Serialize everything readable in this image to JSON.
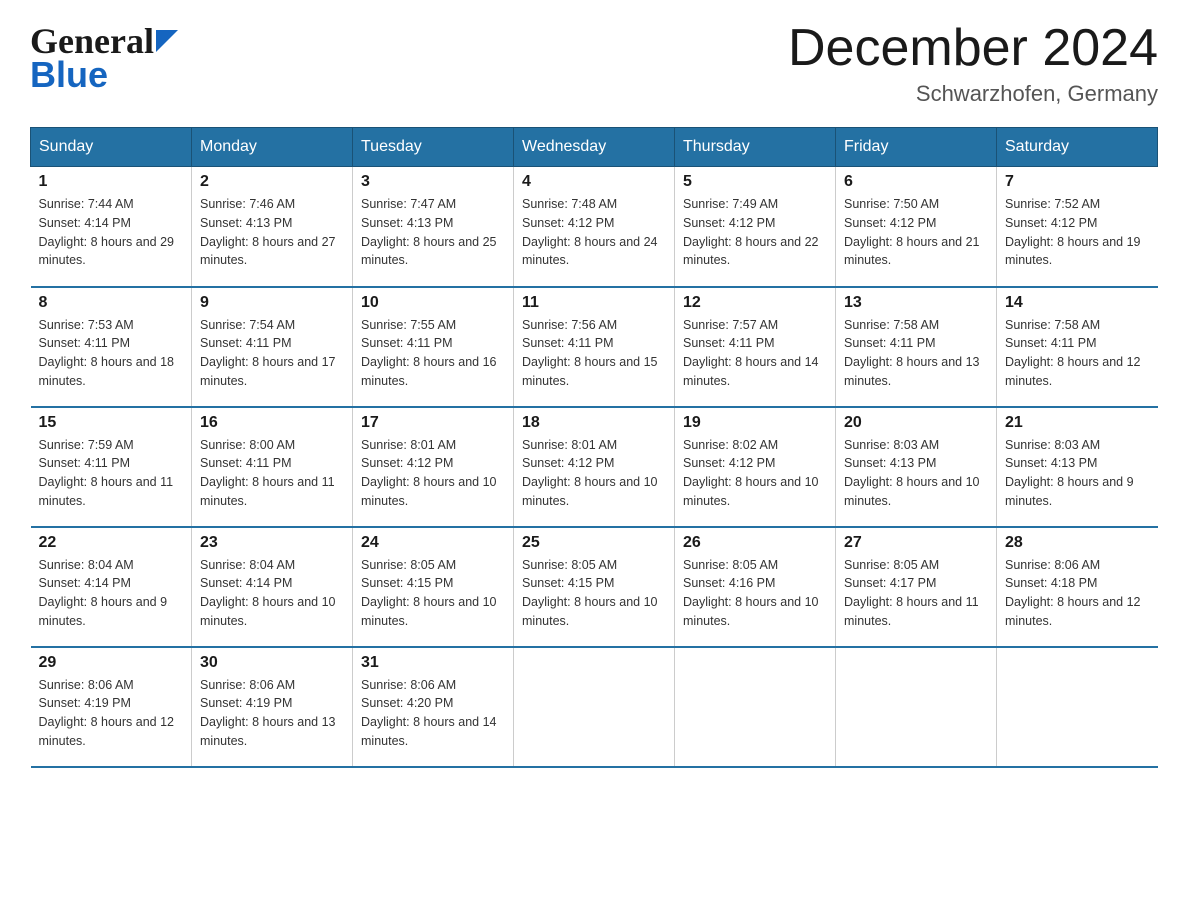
{
  "header": {
    "logo_general": "General",
    "logo_blue": "Blue",
    "month_title": "December 2024",
    "location": "Schwarzhofen, Germany"
  },
  "days_of_week": [
    "Sunday",
    "Monday",
    "Tuesday",
    "Wednesday",
    "Thursday",
    "Friday",
    "Saturday"
  ],
  "weeks": [
    [
      {
        "day": "1",
        "sunrise": "7:44 AM",
        "sunset": "4:14 PM",
        "daylight": "8 hours and 29 minutes."
      },
      {
        "day": "2",
        "sunrise": "7:46 AM",
        "sunset": "4:13 PM",
        "daylight": "8 hours and 27 minutes."
      },
      {
        "day": "3",
        "sunrise": "7:47 AM",
        "sunset": "4:13 PM",
        "daylight": "8 hours and 25 minutes."
      },
      {
        "day": "4",
        "sunrise": "7:48 AM",
        "sunset": "4:12 PM",
        "daylight": "8 hours and 24 minutes."
      },
      {
        "day": "5",
        "sunrise": "7:49 AM",
        "sunset": "4:12 PM",
        "daylight": "8 hours and 22 minutes."
      },
      {
        "day": "6",
        "sunrise": "7:50 AM",
        "sunset": "4:12 PM",
        "daylight": "8 hours and 21 minutes."
      },
      {
        "day": "7",
        "sunrise": "7:52 AM",
        "sunset": "4:12 PM",
        "daylight": "8 hours and 19 minutes."
      }
    ],
    [
      {
        "day": "8",
        "sunrise": "7:53 AM",
        "sunset": "4:11 PM",
        "daylight": "8 hours and 18 minutes."
      },
      {
        "day": "9",
        "sunrise": "7:54 AM",
        "sunset": "4:11 PM",
        "daylight": "8 hours and 17 minutes."
      },
      {
        "day": "10",
        "sunrise": "7:55 AM",
        "sunset": "4:11 PM",
        "daylight": "8 hours and 16 minutes."
      },
      {
        "day": "11",
        "sunrise": "7:56 AM",
        "sunset": "4:11 PM",
        "daylight": "8 hours and 15 minutes."
      },
      {
        "day": "12",
        "sunrise": "7:57 AM",
        "sunset": "4:11 PM",
        "daylight": "8 hours and 14 minutes."
      },
      {
        "day": "13",
        "sunrise": "7:58 AM",
        "sunset": "4:11 PM",
        "daylight": "8 hours and 13 minutes."
      },
      {
        "day": "14",
        "sunrise": "7:58 AM",
        "sunset": "4:11 PM",
        "daylight": "8 hours and 12 minutes."
      }
    ],
    [
      {
        "day": "15",
        "sunrise": "7:59 AM",
        "sunset": "4:11 PM",
        "daylight": "8 hours and 11 minutes."
      },
      {
        "day": "16",
        "sunrise": "8:00 AM",
        "sunset": "4:11 PM",
        "daylight": "8 hours and 11 minutes."
      },
      {
        "day": "17",
        "sunrise": "8:01 AM",
        "sunset": "4:12 PM",
        "daylight": "8 hours and 10 minutes."
      },
      {
        "day": "18",
        "sunrise": "8:01 AM",
        "sunset": "4:12 PM",
        "daylight": "8 hours and 10 minutes."
      },
      {
        "day": "19",
        "sunrise": "8:02 AM",
        "sunset": "4:12 PM",
        "daylight": "8 hours and 10 minutes."
      },
      {
        "day": "20",
        "sunrise": "8:03 AM",
        "sunset": "4:13 PM",
        "daylight": "8 hours and 10 minutes."
      },
      {
        "day": "21",
        "sunrise": "8:03 AM",
        "sunset": "4:13 PM",
        "daylight": "8 hours and 9 minutes."
      }
    ],
    [
      {
        "day": "22",
        "sunrise": "8:04 AM",
        "sunset": "4:14 PM",
        "daylight": "8 hours and 9 minutes."
      },
      {
        "day": "23",
        "sunrise": "8:04 AM",
        "sunset": "4:14 PM",
        "daylight": "8 hours and 10 minutes."
      },
      {
        "day": "24",
        "sunrise": "8:05 AM",
        "sunset": "4:15 PM",
        "daylight": "8 hours and 10 minutes."
      },
      {
        "day": "25",
        "sunrise": "8:05 AM",
        "sunset": "4:15 PM",
        "daylight": "8 hours and 10 minutes."
      },
      {
        "day": "26",
        "sunrise": "8:05 AM",
        "sunset": "4:16 PM",
        "daylight": "8 hours and 10 minutes."
      },
      {
        "day": "27",
        "sunrise": "8:05 AM",
        "sunset": "4:17 PM",
        "daylight": "8 hours and 11 minutes."
      },
      {
        "day": "28",
        "sunrise": "8:06 AM",
        "sunset": "4:18 PM",
        "daylight": "8 hours and 12 minutes."
      }
    ],
    [
      {
        "day": "29",
        "sunrise": "8:06 AM",
        "sunset": "4:19 PM",
        "daylight": "8 hours and 12 minutes."
      },
      {
        "day": "30",
        "sunrise": "8:06 AM",
        "sunset": "4:19 PM",
        "daylight": "8 hours and 13 minutes."
      },
      {
        "day": "31",
        "sunrise": "8:06 AM",
        "sunset": "4:20 PM",
        "daylight": "8 hours and 14 minutes."
      },
      null,
      null,
      null,
      null
    ]
  ]
}
